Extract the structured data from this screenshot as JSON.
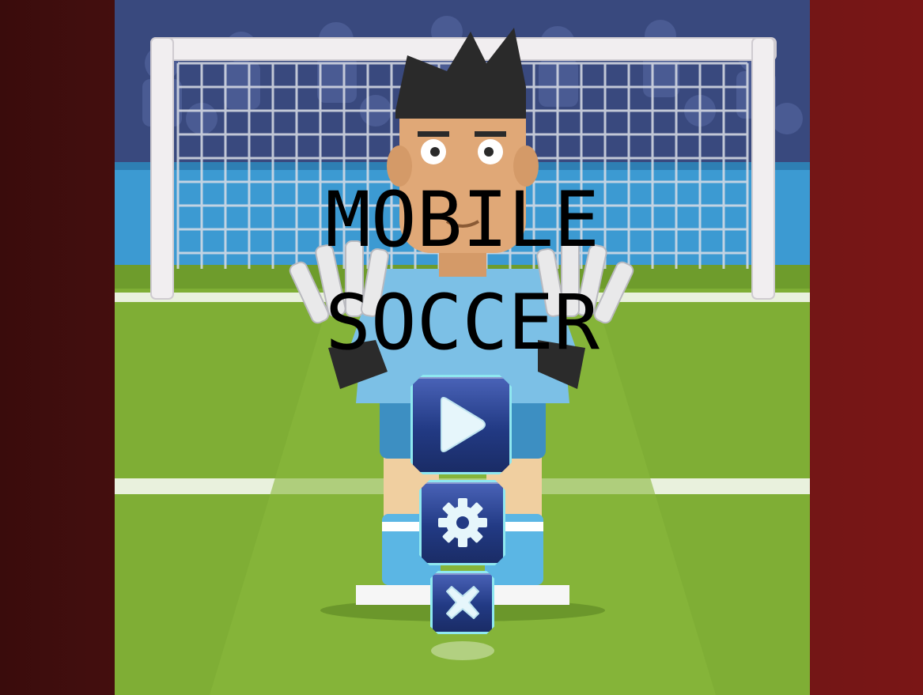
{
  "game": {
    "title_line1": "MOBILE",
    "title_line2": "SOCCER"
  },
  "menu": {
    "buttons": [
      {
        "id": "play",
        "icon": "play-icon"
      },
      {
        "id": "settings",
        "icon": "gear-icon"
      },
      {
        "id": "close",
        "icon": "close-icon"
      }
    ]
  },
  "colors": {
    "page_background": "#6a1414",
    "sky": "#39497e",
    "pitch": "#7fae35",
    "title_fill": "#1f7a22",
    "title_outline": "#e8ffe8",
    "button_fill": "#223a84",
    "button_border": "#8fe8f0",
    "keeper_shirt": "#7cc0e6"
  }
}
